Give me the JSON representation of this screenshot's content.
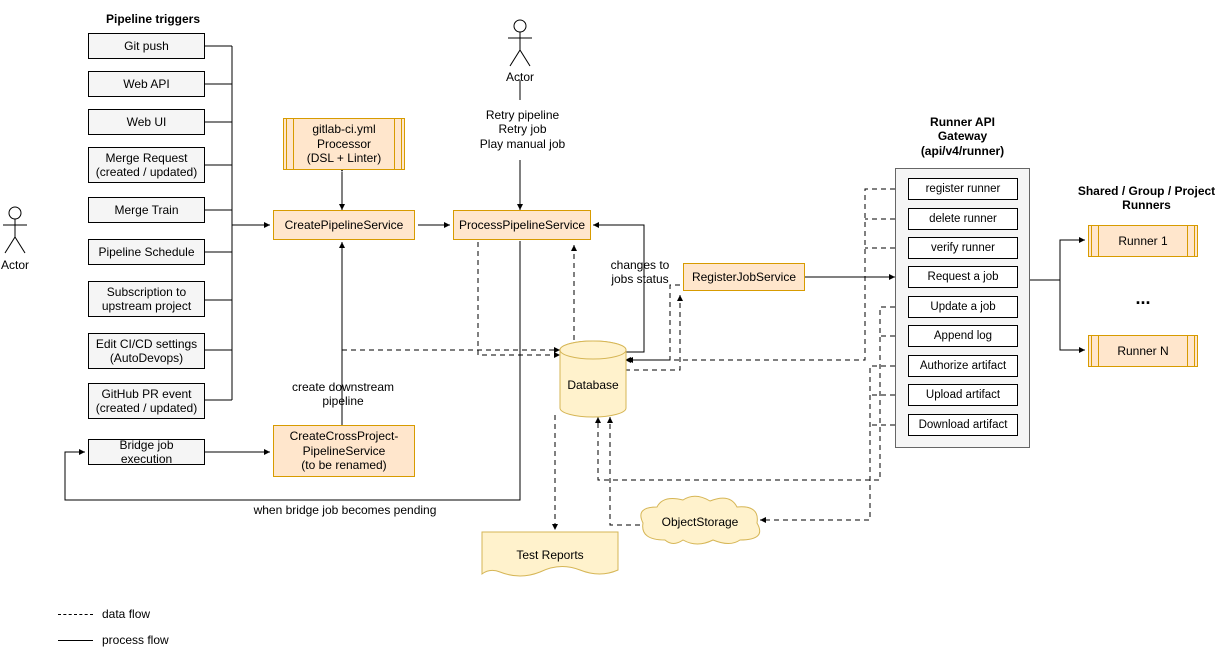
{
  "title_triggers": "Pipeline triggers",
  "triggers": {
    "t0": "Git push",
    "t1": "Web API",
    "t2": "Web UI",
    "t3": "Merge Request\n(created / updated)",
    "t4": "Merge Train",
    "t5": "Pipeline Schedule",
    "t6": "Subscription to\nupstream project",
    "t7": "Edit CI/CD settings\n(AutoDevops)",
    "t8": "GitHub PR event\n(created / updated)"
  },
  "bridge_job": "Bridge job execution",
  "actor_label": "Actor",
  "yml_processor": "gitlab-ci.yml\nProcessor\n(DSL + Linter)",
  "create_pipeline": "CreatePipelineService",
  "cross_project": "CreateCrossProject-\nPipelineService\n(to be renamed)",
  "create_downstream": "create downstream\npipeline",
  "bridge_pending": "when bridge job becomes pending",
  "process_pipeline": "ProcessPipelineService",
  "retry_block": "Retry pipeline\nRetry job\nPlay manual job",
  "changes_status": "changes to\njobs status",
  "database": "Database",
  "test_reports": "Test Reports",
  "object_storage": "ObjectStorage",
  "register_job": "RegisterJobService",
  "gateway_title": "Runner API\nGateway\n(api/v4/runner)",
  "gateway": {
    "g0": "register runner",
    "g1": "delete runner",
    "g2": "verify runner",
    "g3": "Request a job",
    "g4": "Update a job",
    "g5": "Append log",
    "g6": "Authorize artifact",
    "g7": "Upload artifact",
    "g8": "Download artifact"
  },
  "runners_title": "Shared / Group / Project\nRunners",
  "runner1": "Runner 1",
  "runnerN": "Runner N",
  "dots": "...",
  "legend_data": "data flow",
  "legend_process": "process flow"
}
